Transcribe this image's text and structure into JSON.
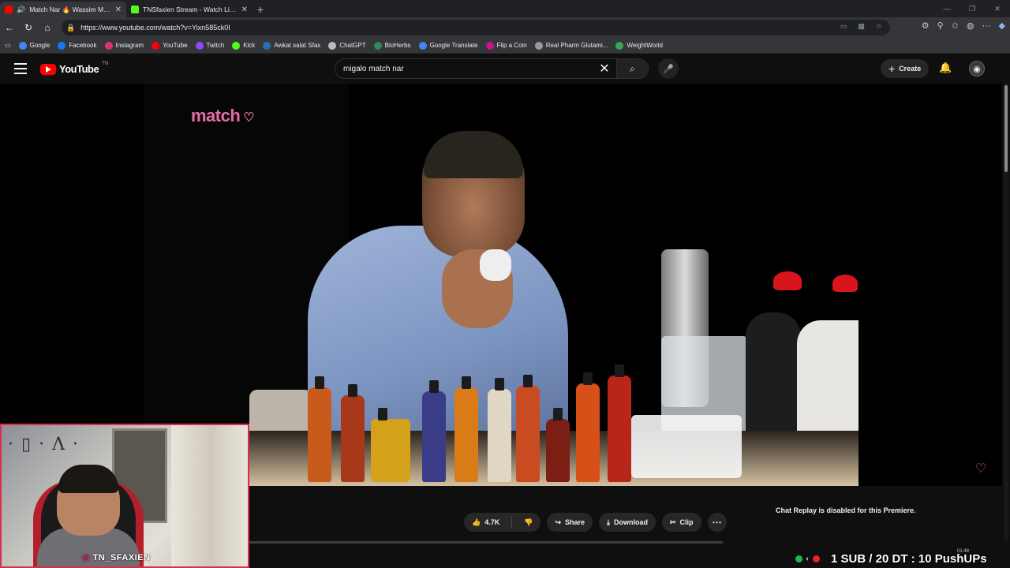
{
  "browser": {
    "tabs": [
      {
        "title": "Match Nar 🔥 Wassim Migal",
        "active": true,
        "favicon_color": "#ff0000"
      },
      {
        "title": "TNSfaxien Stream - Watch Live o",
        "active": false,
        "favicon_color": "#53fc18"
      }
    ],
    "url": "https://www.youtube.com/watch?v=Yixn585ck0I",
    "bookmarks": [
      {
        "label": "Google",
        "color": "#4285f4"
      },
      {
        "label": "Facebook",
        "color": "#1877f2"
      },
      {
        "label": "Instagram",
        "color": "#e1306c"
      },
      {
        "label": "YouTube",
        "color": "#ff0000"
      },
      {
        "label": "Twitch",
        "color": "#9146ff"
      },
      {
        "label": "Kick",
        "color": "#53fc18"
      },
      {
        "label": "Awkat salat Sfax",
        "color": "#2a6fb5"
      },
      {
        "label": "ChatGPT",
        "color": "#bbbbbb"
      },
      {
        "label": "BioHerbs",
        "color": "#2e8b57"
      },
      {
        "label": "Google Translate",
        "color": "#4285f4"
      },
      {
        "label": "Flip a Coin",
        "color": "#c71585"
      },
      {
        "label": "Real Pharm Glutami...",
        "color": "#999999"
      },
      {
        "label": "WeightWorld",
        "color": "#3aa757"
      }
    ]
  },
  "youtube": {
    "logo_text": "YouTube",
    "country_code": "TN",
    "search_value": "migalo match nar",
    "create_label": "Create"
  },
  "video": {
    "watermark": "match",
    "actions": {
      "likes": "4.7K",
      "share": "Share",
      "download": "Download",
      "clip": "Clip"
    },
    "chat_replay": "Chat Replay is disabled for this Premiere."
  },
  "stream_overlay": {
    "handle": "TN_SFAXIEN",
    "goal": "1 SUB / 20 DT : 10 PushUPs",
    "clock": "01:48"
  }
}
